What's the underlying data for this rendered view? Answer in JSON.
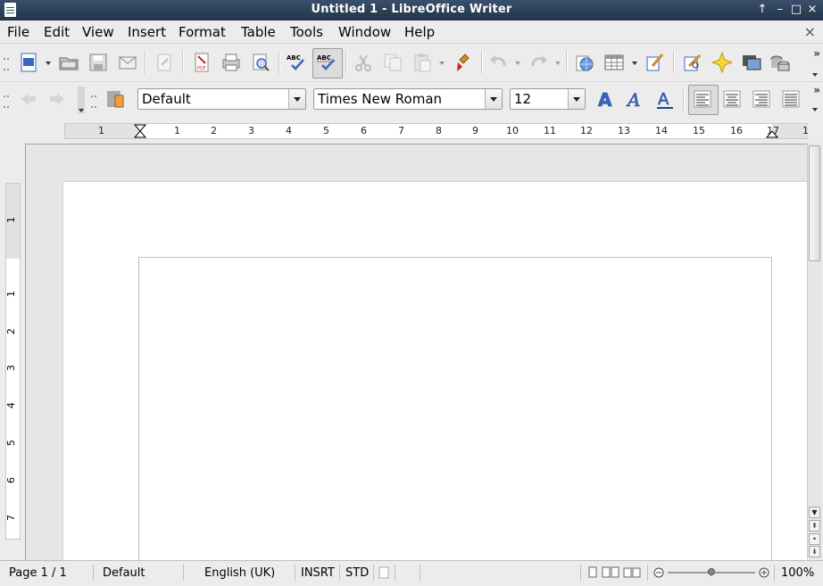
{
  "window": {
    "title": "Untitled 1 - LibreOffice Writer"
  },
  "menubar": {
    "items": [
      "File",
      "Edit",
      "View",
      "Insert",
      "Format",
      "Table",
      "Tools",
      "Window",
      "Help"
    ]
  },
  "toolbar_standard": {
    "icons": [
      "new-document-icon",
      "open-folder-icon",
      "save-icon",
      "email-icon",
      "edit-mode-icon",
      "export-pdf-icon",
      "print-icon",
      "print-preview-icon",
      "spellcheck-icon",
      "auto-spellcheck-icon",
      "cut-icon",
      "copy-icon",
      "paste-icon",
      "clone-formatting-icon",
      "undo-icon",
      "redo-icon",
      "hyperlink-icon",
      "table-icon",
      "draw-functions-icon",
      "find-replace-icon",
      "navigator-icon",
      "gallery-icon",
      "data-sources-icon"
    ]
  },
  "toolbar_formatting": {
    "paragraph_style": "Default",
    "font_name": "Times New Roman",
    "font_size": "12",
    "icons": [
      "bold-icon",
      "italic-icon",
      "underline-icon",
      "align-left-icon",
      "align-center-icon",
      "align-right-icon",
      "justify-icon"
    ]
  },
  "ruler": {
    "h_numbers": [
      "1",
      "1",
      "2",
      "3",
      "4",
      "5",
      "6",
      "7",
      "8",
      "9",
      "10",
      "11",
      "12",
      "13",
      "14",
      "15",
      "16",
      "17",
      "1"
    ],
    "v_numbers": [
      "1",
      "1",
      "2",
      "3",
      "4",
      "5",
      "6",
      "7"
    ]
  },
  "status": {
    "page": "Page 1 / 1",
    "page_style": "Default",
    "language": "English (UK)",
    "insert_mode": "INSRT",
    "selection_mode": "STD",
    "zoom_percent": "100%",
    "zoom_level": 0.5
  },
  "colors": {
    "titlebar": "#2b3d55",
    "accent_blue": "#3a67c4"
  }
}
